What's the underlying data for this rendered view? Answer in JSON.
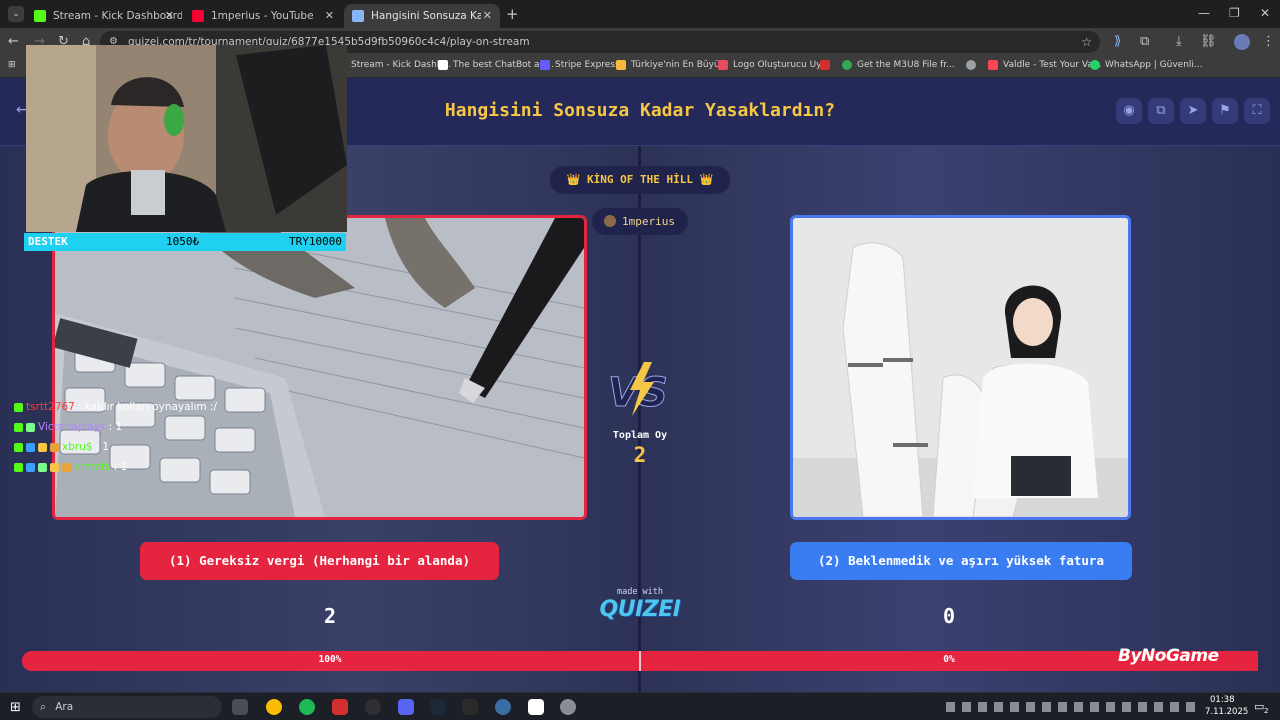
{
  "browser": {
    "tabs": [
      {
        "title": "Stream - Kick Dashboard",
        "favicon_color": "#53fc18",
        "active": false
      },
      {
        "title": "1mperius - YouTube",
        "favicon_color": "#ff0033",
        "active": false
      },
      {
        "title": "Hangisini Sonsuza Kadar Yasakl",
        "favicon_color": "#8ab4f8",
        "active": true
      }
    ],
    "url": "quizei.com/tr/tournament/quiz/6877e1545b5d9fb50960c4c4/play-on-stream",
    "bookmarks": [
      {
        "label": "Stream - Kick Dashb...",
        "color": "#53fc18"
      },
      {
        "label": "The best ChatBot an...",
        "color": "#ffffff"
      },
      {
        "label": "Stripe Express",
        "color": "#635bff"
      },
      {
        "label": "Türkiye'nin En Büyü...",
        "color": "#f6b93b"
      },
      {
        "label": "Logo Oluşturucu Uy...",
        "color": "#e84a5f"
      },
      {
        "label": "",
        "color": "#d32f2f"
      },
      {
        "label": "Get the M3U8 File fr...",
        "color": "#34a853"
      },
      {
        "label": "",
        "color": "#9aa0a6"
      },
      {
        "label": "Valdle - Test Your Va...",
        "color": "#ff4655"
      },
      {
        "label": "WhatsApp | Güvenli...",
        "color": "#25d366"
      }
    ]
  },
  "quiz": {
    "title": "Hangisini Sonsuza Kadar Yasaklardın?",
    "mode_badge": "👑 KİNG OF THE HİLL 👑",
    "streamer": "1mperius",
    "left_option": "(1) Gereksiz vergi (Herhangi bir alanda)",
    "right_option": "(2) Beklenmedik ve aşırı yüksek fatura",
    "left_votes": "2",
    "right_votes": "0",
    "total_label": "Toplam Oy",
    "total_votes": "2",
    "left_percent_label": "100%",
    "right_percent_label": "0%",
    "left_share": 1.0,
    "made_with": "made with",
    "brand": "QUIZEI",
    "accent_left": "#e5243f",
    "accent_right": "#3a7df2",
    "title_color": "#f6c744"
  },
  "overlay": {
    "donate_label": "DESTEK",
    "donate_amount": "1050₺",
    "donate_goal": "TRY10000",
    "sponsor": "ByNoGame",
    "chat": [
      {
        "user": "tsrtt2767",
        "text": ": kaldır kolları oynayalım :/",
        "user_color": "#ff3b3b"
      },
      {
        "user": "Victoriaplays",
        "text": ": 1",
        "user_color": "#b388ff"
      },
      {
        "user": "xbru$",
        "text": ": 1",
        "user_color": "#53fc18"
      },
      {
        "user": "krmnts",
        "text": ": 1",
        "user_color": "#53fc18"
      }
    ]
  },
  "taskbar": {
    "search_label": "Ara",
    "time": "01:38",
    "date": "7.11.2025",
    "notification_count": "2"
  }
}
